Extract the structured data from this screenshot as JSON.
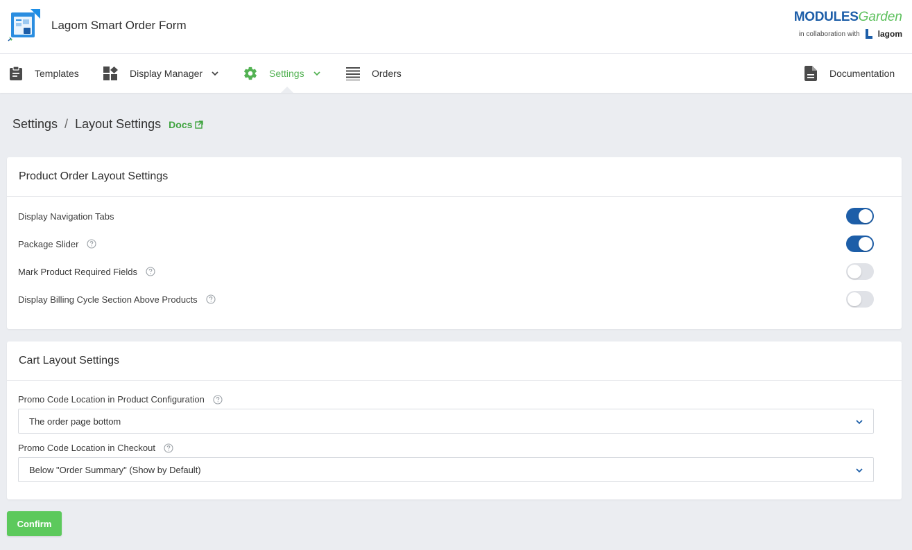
{
  "header": {
    "app_title": "Lagom Smart Order Form",
    "brand": {
      "name_part1": "MODULES",
      "name_part2": "Garden",
      "collab_text": "in collaboration with",
      "partner": "lagom"
    }
  },
  "nav": {
    "items": [
      {
        "label": "Templates",
        "icon": "clipboard-icon"
      },
      {
        "label": "Display Manager",
        "icon": "dashboard-blocks-icon"
      },
      {
        "label": "Settings",
        "icon": "gear-icon"
      },
      {
        "label": "Orders",
        "icon": "list-lines-icon"
      },
      {
        "label": "Documentation",
        "icon": "document-icon"
      }
    ],
    "active": "Settings"
  },
  "breadcrumb": {
    "parent": "Settings",
    "separator": "/",
    "current": "Layout Settings",
    "docs_label": "Docs"
  },
  "product_layout": {
    "title": "Product Order Layout Settings",
    "settings": [
      {
        "label": "Display Navigation Tabs",
        "enabled": true,
        "help": false
      },
      {
        "label": "Package Slider",
        "enabled": true,
        "help": true
      },
      {
        "label": "Mark Product Required Fields",
        "enabled": false,
        "help": true
      },
      {
        "label": "Display Billing Cycle Section Above Products",
        "enabled": false,
        "help": true
      }
    ]
  },
  "cart_layout": {
    "title": "Cart Layout Settings",
    "fields": [
      {
        "label": "Promo Code Location in Product Configuration",
        "value": "The order page bottom"
      },
      {
        "label": "Promo Code Location in Checkout",
        "value": "Below \"Order Summary\" (Show by Default)"
      }
    ]
  },
  "actions": {
    "confirm_label": "Confirm"
  },
  "colors": {
    "accent_green": "#5cc95c",
    "toggle_on": "#1d5ea8",
    "toggle_off": "#e0e2e7",
    "page_bg": "#ebedf1"
  }
}
